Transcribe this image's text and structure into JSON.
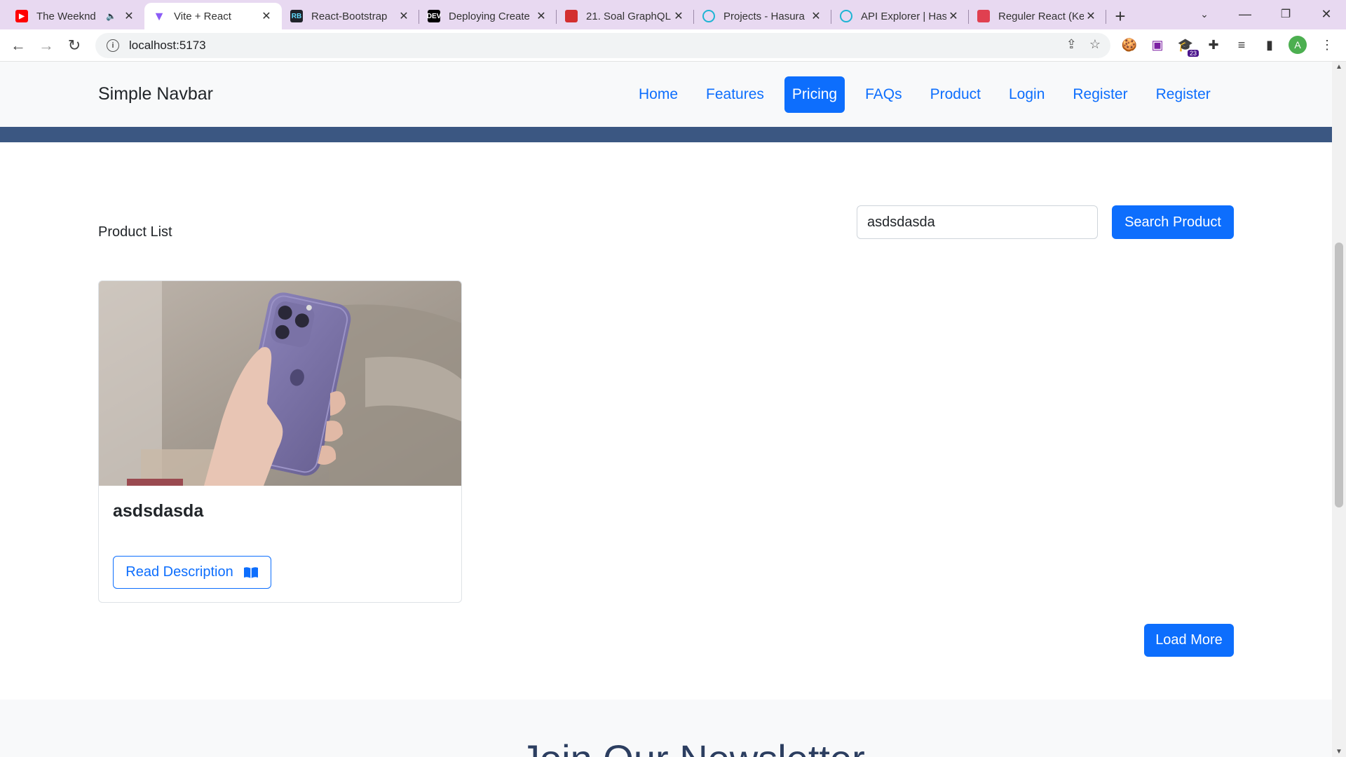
{
  "browser": {
    "tabs": [
      {
        "title": "The Weeknd",
        "favicon": "youtube-icon",
        "color": "#ff0000",
        "audio": true
      },
      {
        "title": "Vite + React",
        "favicon": "vite-icon",
        "color": "#8b5cf6",
        "active": true
      },
      {
        "title": "React-Bootstrap",
        "favicon": "react-bootstrap-icon",
        "color": "#20232a"
      },
      {
        "title": "Deploying Create",
        "favicon": "dev-icon",
        "color": "#000000"
      },
      {
        "title": "21. Soal GraphQL",
        "favicon": "book-icon",
        "color": "#d32f2f"
      },
      {
        "title": "Projects - Hasura",
        "favicon": "hasura-icon",
        "color": "#1eb4d4"
      },
      {
        "title": "API Explorer | Has",
        "favicon": "hasura-icon",
        "color": "#1eb4d4"
      },
      {
        "title": "Reguler React (Ke",
        "favicon": "tie-icon",
        "color": "#e04050"
      }
    ],
    "url": "localhost:5173",
    "extension_badge": "23",
    "profile_initial": "A"
  },
  "navbar": {
    "brand": "Simple Navbar",
    "links": [
      {
        "label": "Home"
      },
      {
        "label": "Features"
      },
      {
        "label": "Pricing",
        "active": true
      },
      {
        "label": "FAQs"
      },
      {
        "label": "Product"
      },
      {
        "label": "Login"
      },
      {
        "label": "Register"
      },
      {
        "label": "Register"
      }
    ]
  },
  "main": {
    "list_title": "Product List",
    "search": {
      "value": "asdsdasda",
      "button_label": "Search Product"
    },
    "products": [
      {
        "name": "asdsdasda",
        "button_label": "Read Description"
      }
    ],
    "load_more_label": "Load More"
  },
  "newsletter": {
    "title": "Join Our Newsletter"
  },
  "colors": {
    "primary": "#0d6efd",
    "band": "#3b5782"
  }
}
